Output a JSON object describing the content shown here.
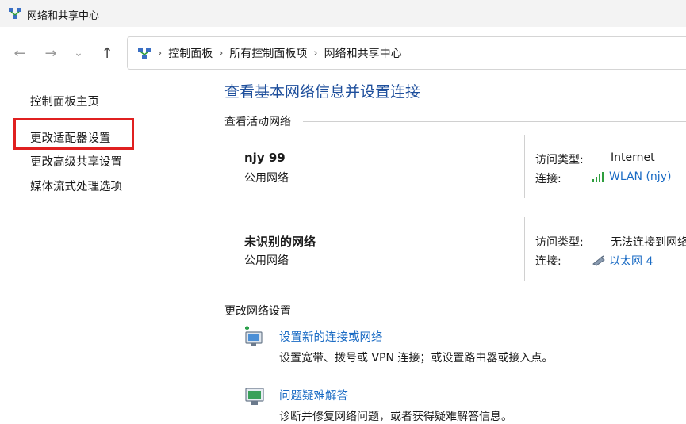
{
  "window": {
    "title": "网络和共享中心"
  },
  "nav": {
    "back": "←",
    "forward": "→",
    "recent": "⌄",
    "up": "↑"
  },
  "breadcrumb": [
    "控制面板",
    "所有控制面板项",
    "网络和共享中心"
  ],
  "sidebar": {
    "items": [
      {
        "label": "控制面板主页"
      },
      {
        "label": "更改适配器设置",
        "highlighted": true
      },
      {
        "label": "更改高级共享设置"
      },
      {
        "label": "媒体流式处理选项"
      }
    ],
    "highlight_color": "#e02020"
  },
  "main": {
    "title": "查看基本网络信息并设置连接",
    "active_networks_heading": "查看活动网络",
    "networks": [
      {
        "name": "njy 99",
        "type": "公用网络",
        "access_label": "访问类型:",
        "access_value": "Internet",
        "conn_label": "连接:",
        "conn_value": "WLAN (njy)",
        "conn_icon": "wifi-signal-icon"
      },
      {
        "name": "未识别的网络",
        "type": "公用网络",
        "access_label": "访问类型:",
        "access_value": "无法连接到网络",
        "conn_label": "连接:",
        "conn_value": "以太网 4",
        "conn_icon": "ethernet-icon"
      }
    ],
    "change_settings_heading": "更改网络设置",
    "tasks": [
      {
        "label": "设置新的连接或网络",
        "desc": "设置宽带、拨号或 VPN 连接；或设置路由器或接入点。",
        "icon": "new-connection-icon"
      },
      {
        "label": "问题疑难解答",
        "desc": "诊断并修复网络问题，或者获得疑难解答信息。",
        "icon": "troubleshoot-icon"
      }
    ]
  },
  "colors": {
    "link": "#1a6bc4",
    "title": "#1e4f9c"
  }
}
